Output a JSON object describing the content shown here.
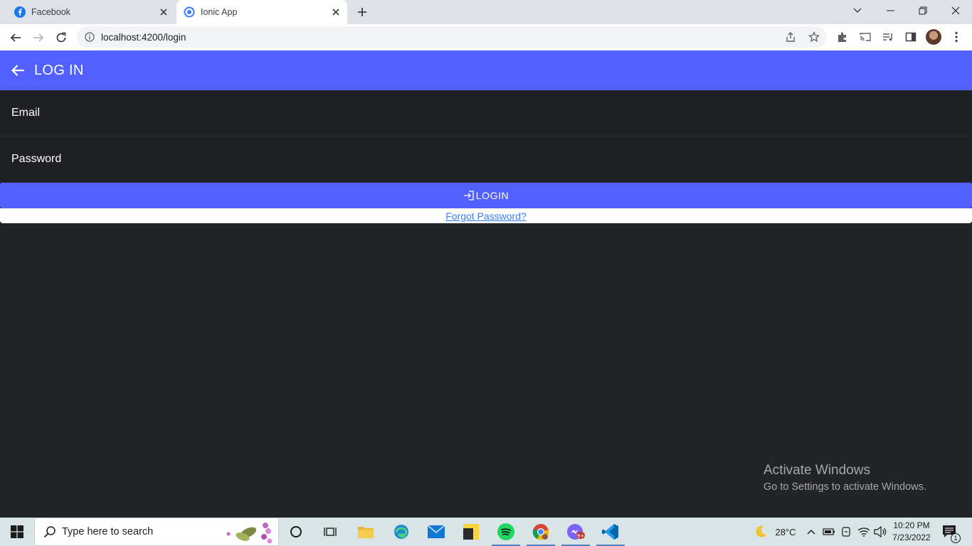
{
  "browser": {
    "tabs": [
      {
        "title": "Facebook",
        "icon": "facebook-icon",
        "active": false
      },
      {
        "title": "Ionic App",
        "icon": "ionic-icon",
        "active": true
      }
    ],
    "url": "localhost:4200/login"
  },
  "app": {
    "header_title": "LOG IN",
    "fields": {
      "email_label": "Email",
      "password_label": "Password"
    },
    "login_button": "LOGIN",
    "forgot_link": "Forgot Password?",
    "colors": {
      "primary": "#5260ff",
      "background": "#222428",
      "link": "#3880ff"
    }
  },
  "watermark": {
    "title": "Activate Windows",
    "subtitle": "Go to Settings to activate Windows."
  },
  "taskbar": {
    "search_placeholder": "Type here to search",
    "temperature": "28°C",
    "time": "10:20 PM",
    "date": "7/23/2022",
    "notification_count": "1"
  }
}
